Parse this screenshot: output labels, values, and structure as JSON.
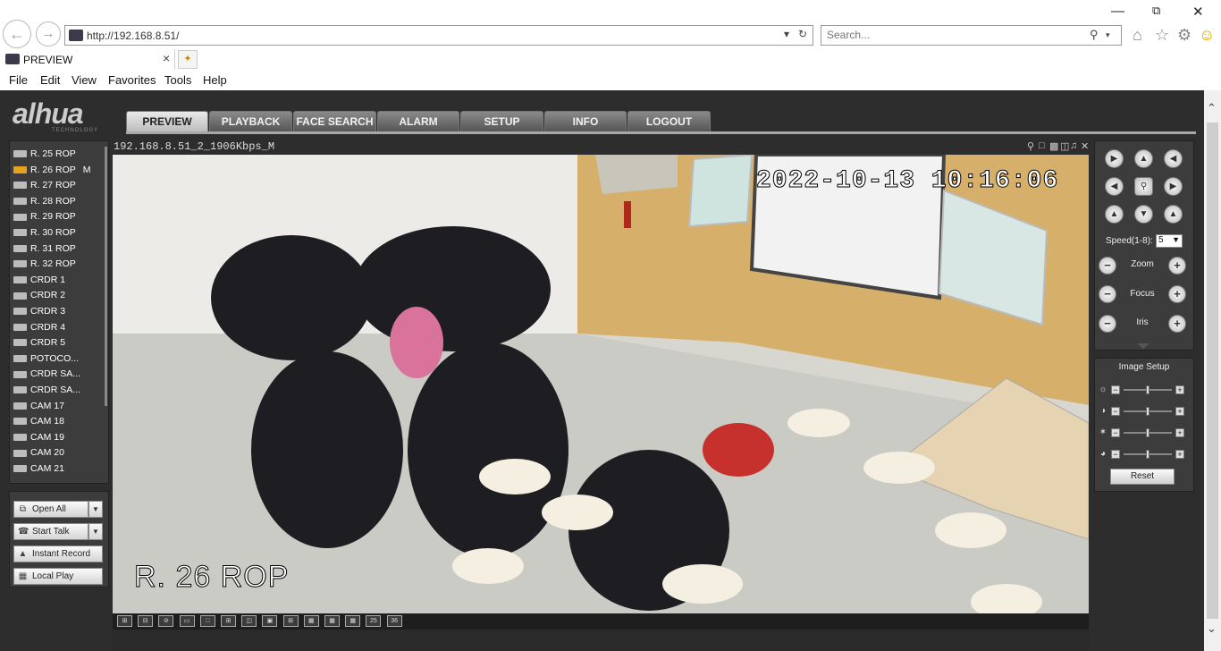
{
  "browser": {
    "url": "http://192.168.8.51/",
    "search_placeholder": "Search...",
    "tab_title": "PREVIEW",
    "menu": [
      "File",
      "Edit",
      "View",
      "Favorites",
      "Tools",
      "Help"
    ]
  },
  "app": {
    "logo": "alhua",
    "logo_sub": "TECHNOLOGY",
    "nav_tabs": [
      "PREVIEW",
      "PLAYBACK",
      "FACE SEARCH",
      "ALARM",
      "SETUP",
      "INFO",
      "LOGOUT"
    ],
    "active_tab": "PREVIEW",
    "devices": [
      {
        "label": "R. 25 ROP",
        "marker": "",
        "active": false
      },
      {
        "label": "R. 26 ROP",
        "marker": "M",
        "active": true
      },
      {
        "label": "R. 27 ROP",
        "marker": "",
        "active": false
      },
      {
        "label": "R. 28 ROP",
        "marker": "",
        "active": false
      },
      {
        "label": "R. 29 ROP",
        "marker": "",
        "active": false
      },
      {
        "label": "R. 30 ROP",
        "marker": "",
        "active": false
      },
      {
        "label": "R. 31 ROP",
        "marker": "",
        "active": false
      },
      {
        "label": "R. 32 ROP",
        "marker": "",
        "active": false
      },
      {
        "label": "CRDR 1",
        "marker": "",
        "active": false
      },
      {
        "label": "CRDR 2",
        "marker": "",
        "active": false
      },
      {
        "label": "CRDR 3",
        "marker": "",
        "active": false
      },
      {
        "label": "CRDR 4",
        "marker": "",
        "active": false
      },
      {
        "label": "CRDR 5",
        "marker": "",
        "active": false
      },
      {
        "label": "POTOCO...",
        "marker": "",
        "active": false
      },
      {
        "label": "CRDR SA...",
        "marker": "",
        "active": false
      },
      {
        "label": "CRDR SA...",
        "marker": "",
        "active": false
      },
      {
        "label": "CAM 17",
        "marker": "",
        "active": false
      },
      {
        "label": "CAM 18",
        "marker": "",
        "active": false
      },
      {
        "label": "CAM 19",
        "marker": "",
        "active": false
      },
      {
        "label": "CAM 20",
        "marker": "",
        "active": false
      },
      {
        "label": "CAM 21",
        "marker": "",
        "active": false
      }
    ],
    "actions": {
      "open_all": "Open All",
      "start_talk": "Start Talk",
      "instant_record": "Instant Record",
      "local_play": "Local Play"
    },
    "video": {
      "stream_info": "192.168.8.51_2_1906Kbps_M",
      "osd_time": "2022-10-13 10:16:06",
      "osd_name": "R. 26 ROP"
    },
    "layouts": [
      "1",
      "2",
      "3",
      "4",
      "5",
      "6",
      "7",
      "8",
      "9",
      "10",
      "11",
      "12",
      "25",
      "36"
    ],
    "ptz": {
      "speed_label": "Speed(1-8):",
      "speed_value": "5",
      "zoom": "Zoom",
      "focus": "Focus",
      "iris": "Iris"
    },
    "image_setup": {
      "title": "Image Setup",
      "reset": "Reset",
      "sliders": [
        {
          "name": "brightness",
          "icon": "sun-icon",
          "level": 0.5
        },
        {
          "name": "contrast",
          "icon": "contrast-icon",
          "level": 0.5
        },
        {
          "name": "saturation",
          "icon": "saturation-icon",
          "level": 0.5
        },
        {
          "name": "hue",
          "icon": "palette-icon",
          "level": 0.5
        }
      ]
    }
  },
  "colors": {
    "app_bg": "#2d2d2d",
    "panel_bg": "#3c3c3c",
    "active_camera": "#e8a020"
  }
}
